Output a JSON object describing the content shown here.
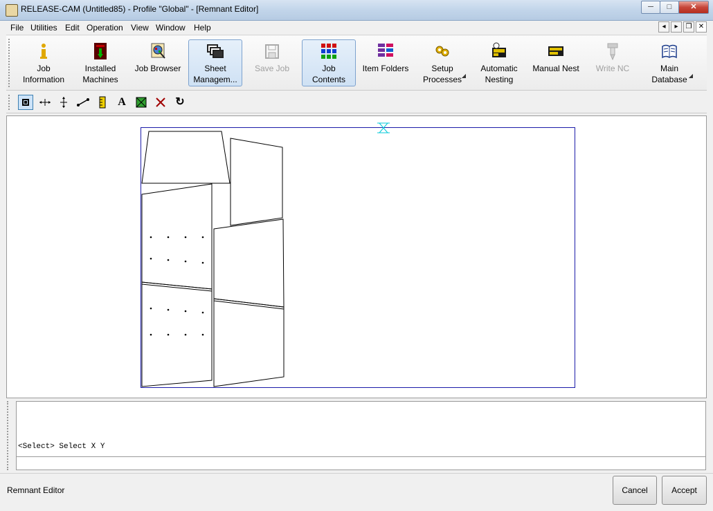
{
  "window": {
    "title": "RELEASE-CAM (Untitled85) - Profile \"Global\" - [Remnant Editor]",
    "minimize": "─",
    "maximize": "□",
    "close": "✕"
  },
  "menubar": {
    "items": [
      "File",
      "Utilities",
      "Edit",
      "Operation",
      "View",
      "Window",
      "Help"
    ],
    "mdi": {
      "prev": "◂",
      "next": "▸",
      "restore": "❐",
      "close": "✕"
    }
  },
  "toolbar": {
    "buttons": [
      {
        "label": "Job\nInformation",
        "icon": "info-icon",
        "state": "normal"
      },
      {
        "label": "Installed\nMachines",
        "icon": "machine-icon",
        "state": "normal"
      },
      {
        "label": "Job Browser",
        "icon": "job-browser-icon",
        "state": "normal"
      },
      {
        "label": "Sheet\nManagem...",
        "icon": "sheet-management-icon",
        "state": "active"
      },
      {
        "label": "Save Job",
        "icon": "save-icon",
        "state": "disabled"
      },
      {
        "label": "Job\nContents",
        "icon": "job-contents-icon",
        "state": "active"
      },
      {
        "label": "Item Folders",
        "icon": "item-folders-icon",
        "state": "normal"
      },
      {
        "label": "Setup\nProcesses",
        "icon": "setup-processes-icon",
        "state": "normal",
        "dropdown": true
      },
      {
        "label": "Automatic\nNesting",
        "icon": "automatic-nesting-icon",
        "state": "normal"
      },
      {
        "label": "Manual Nest",
        "icon": "manual-nest-icon",
        "state": "normal"
      },
      {
        "label": "Write NC",
        "icon": "write-nc-icon",
        "state": "disabled"
      },
      {
        "label": "Main\nDatabase",
        "icon": "main-database-icon",
        "state": "normal",
        "dropdown": true
      }
    ]
  },
  "tools": [
    {
      "name": "select-tool",
      "glyph": "▪",
      "active": true
    },
    {
      "name": "horizontal-cut-tool",
      "glyph": "⟺"
    },
    {
      "name": "vertical-cut-tool",
      "glyph": "⇕"
    },
    {
      "name": "line-tool",
      "glyph": "⟋"
    },
    {
      "name": "measure-tool",
      "glyph": "▮"
    },
    {
      "name": "text-tool",
      "glyph": "A"
    },
    {
      "name": "fill-remnant-tool",
      "glyph": "▩"
    },
    {
      "name": "delete-tool",
      "glyph": "✕"
    },
    {
      "name": "undo-tool",
      "glyph": "↻"
    }
  ],
  "colors": {
    "sheet_border": "#1a1aa8",
    "part_stroke": "#000000",
    "origin_marker": "#00c8d8",
    "active_highlight": "#cfe1f4",
    "delete_red": "#c00000"
  },
  "command": {
    "prompt": "<Select> Select X Y",
    "input": ""
  },
  "status": {
    "text": "Remnant Editor",
    "cancel_label": "Cancel",
    "accept_label": "Accept"
  }
}
